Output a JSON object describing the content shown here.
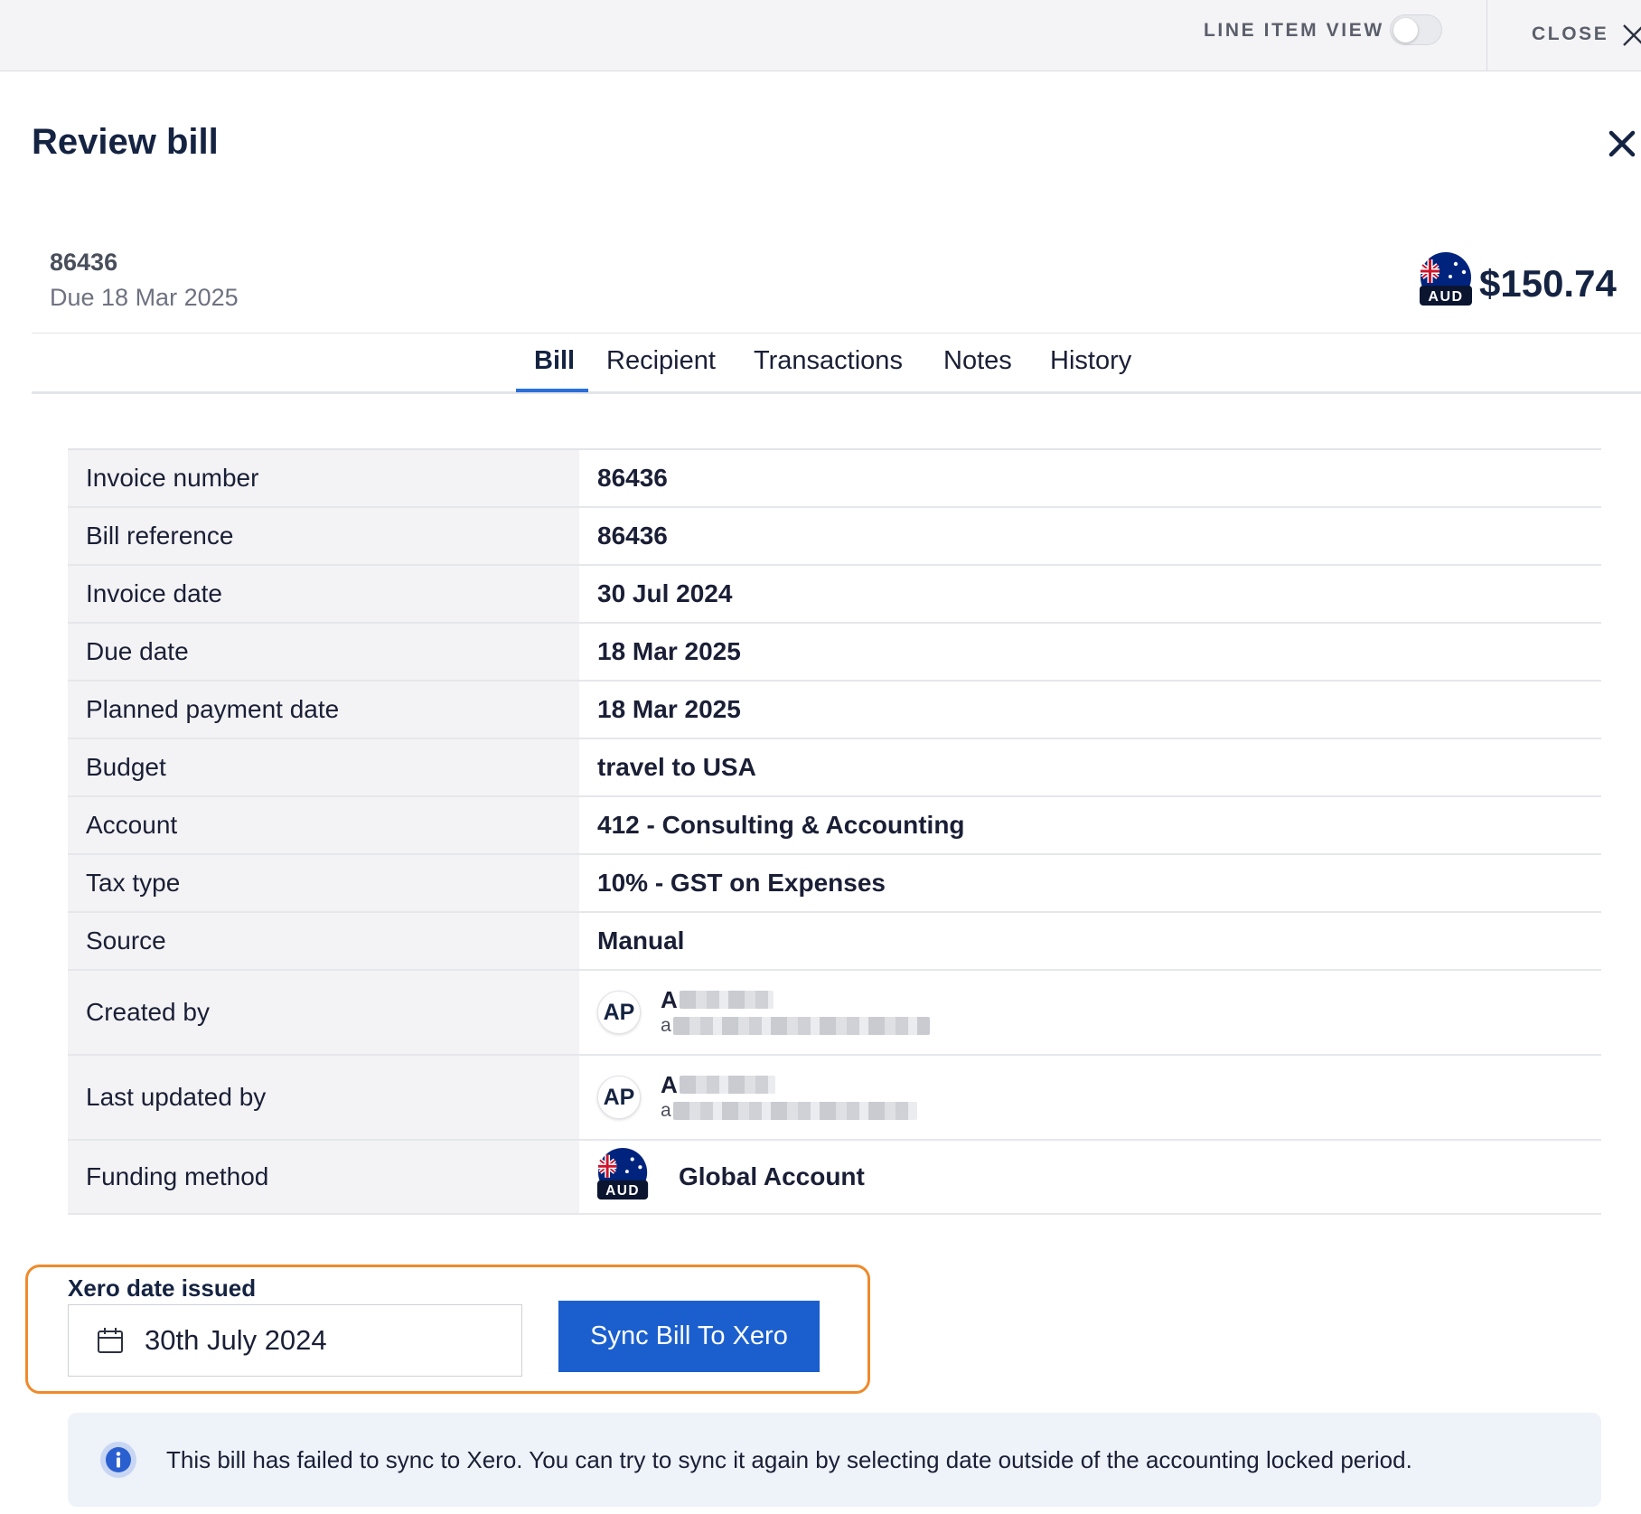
{
  "topbar": {
    "line_item_view_label": "LINE ITEM VIEW",
    "line_item_view_on": false,
    "close_label": "CLOSE"
  },
  "page": {
    "title": "Review bill"
  },
  "bill": {
    "number": "86436",
    "due": "Due 18 Mar 2025",
    "currency": "AUD",
    "amount": "$150.74"
  },
  "tabs": [
    {
      "label": "Bill",
      "active": true
    },
    {
      "label": "Recipient",
      "active": false
    },
    {
      "label": "Transactions",
      "active": false
    },
    {
      "label": "Notes",
      "active": false
    },
    {
      "label": "History",
      "active": false
    }
  ],
  "details": {
    "invoice_number": {
      "label": "Invoice number",
      "value": "86436"
    },
    "bill_reference": {
      "label": "Bill reference",
      "value": "86436"
    },
    "invoice_date": {
      "label": "Invoice date",
      "value": "30 Jul 2024"
    },
    "due_date": {
      "label": "Due date",
      "value": "18 Mar 2025"
    },
    "planned_payment_date": {
      "label": "Planned payment date",
      "value": "18 Mar 2025"
    },
    "budget": {
      "label": "Budget",
      "value": "travel to USA"
    },
    "account": {
      "label": "Account",
      "value": "412 - Consulting & Accounting"
    },
    "tax_type": {
      "label": "Tax type",
      "value": "10% - GST on Expenses"
    },
    "source": {
      "label": "Source",
      "value": "Manual"
    },
    "created_by": {
      "label": "Created by",
      "initials": "AP",
      "name_visible": "A",
      "email_visible": "a"
    },
    "last_updated_by": {
      "label": "Last updated by",
      "initials": "AP",
      "name_visible": "A",
      "email_visible": "a"
    },
    "funding_method": {
      "label": "Funding method",
      "currency": "AUD",
      "value": "Global Account"
    }
  },
  "xero": {
    "title": "Xero date issued",
    "date_value": "30th July 2024",
    "sync_button": "Sync Bill To Xero"
  },
  "info_banner": {
    "text": "This bill has failed to sync to Xero. You can try to sync it again by selecting date outside of the accounting locked period."
  },
  "colors": {
    "accent": "#1b5fce",
    "tab_underline": "#2a6fdb",
    "highlight_border": "#ef8a2b",
    "title": "#152342",
    "flag_blue": "#00247d",
    "flag_red": "#cf142b"
  }
}
